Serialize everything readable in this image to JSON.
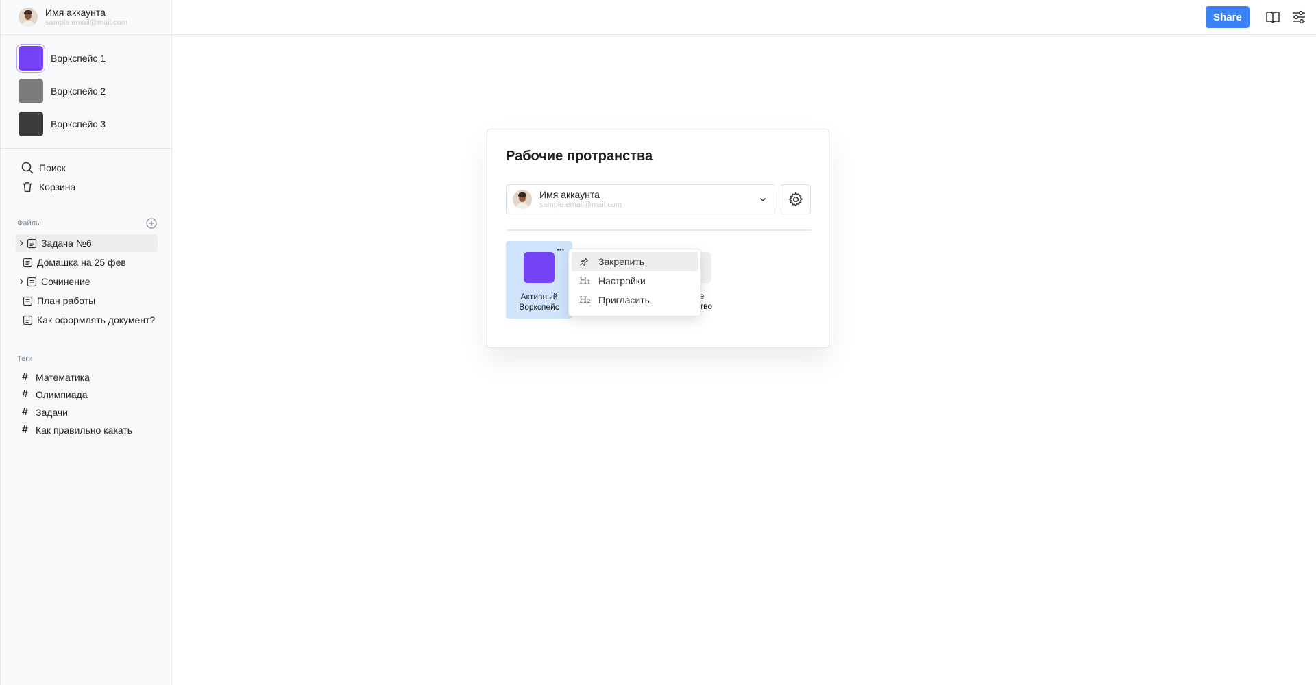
{
  "account": {
    "name": "Имя аккаунта",
    "email": "sample.email@mail.com"
  },
  "workspaces": [
    {
      "label": "Воркспейс 1",
      "color": "#7443f5",
      "active": true
    },
    {
      "label": "Воркспейс 2",
      "color": "#7b7b7b",
      "active": false
    },
    {
      "label": "Воркспейс 3",
      "color": "#3c3c3c",
      "active": false
    }
  ],
  "nav": {
    "search": "Поиск",
    "trash": "Корзина"
  },
  "files": {
    "title": "Файлы",
    "items": [
      {
        "label": "Задача №6",
        "expandable": true
      },
      {
        "label": "Домашка на 25 фев",
        "expandable": false
      },
      {
        "label": "Сочинение",
        "expandable": true
      },
      {
        "label": "План работы",
        "expandable": false
      },
      {
        "label": "Как оформлять документ?",
        "expandable": false
      }
    ]
  },
  "tags": {
    "title": "Теги",
    "items": [
      "Математика",
      "Олимпиада",
      "Задачи",
      "Как правильно какать"
    ]
  },
  "topbar": {
    "share_label": "Share",
    "share_color": "#3b82f6"
  },
  "modal": {
    "title": "Рабочие протранства",
    "active_card": {
      "line1": "Активный",
      "line2": "Воркспейс",
      "more": "···"
    },
    "ghost_card": {
      "line1": "ре",
      "line2": "нство"
    }
  },
  "context_menu": {
    "items": [
      {
        "label": "Закрепить",
        "icon": "pin-icon"
      },
      {
        "label": "Настройки",
        "icon": "heading-1-icon",
        "glyph": "H₁"
      },
      {
        "label": "Пригласить",
        "icon": "heading-2-icon",
        "glyph": "H₂"
      }
    ]
  }
}
